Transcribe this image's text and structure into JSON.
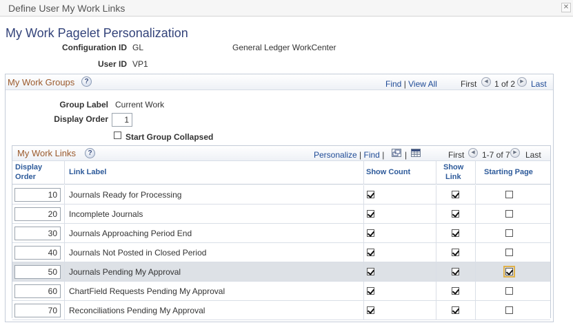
{
  "window": {
    "title": "Define User My Work Links",
    "close_glyph": "✕"
  },
  "page_title": "My Work Pagelet Personalization",
  "config": {
    "config_id_label": "Configuration ID",
    "config_id_value": "GL",
    "config_desc": "General Ledger WorkCenter",
    "user_id_label": "User ID",
    "user_id_value": "VP1"
  },
  "groups": {
    "title": "My Work Groups",
    "help_glyph": "?",
    "find": "Find",
    "view_all": "View All",
    "first": "First",
    "range": "1 of 2",
    "last": "Last",
    "group_label_label": "Group Label",
    "group_label_value": "Current Work",
    "display_order_label": "Display Order",
    "display_order_value": "1",
    "start_collapsed_label": "Start Group Collapsed",
    "start_collapsed_checked": false
  },
  "links": {
    "title": "My Work Links",
    "help_glyph": "?",
    "personalize": "Personalize",
    "find": "Find",
    "first": "First",
    "range": "1-7 of 7",
    "last": "Last",
    "columns": {
      "display_order_1": "Display",
      "display_order_2": "Order",
      "link_label": "Link Label",
      "show_count": "Show Count",
      "show_link_1": "Show",
      "show_link_2": "Link",
      "starting_page": "Starting Page"
    },
    "rows": [
      {
        "order": "10",
        "label": "Journals Ready for Processing",
        "show_count": true,
        "show_link": true,
        "starting_page": false
      },
      {
        "order": "20",
        "label": "Incomplete Journals",
        "show_count": true,
        "show_link": true,
        "starting_page": false
      },
      {
        "order": "30",
        "label": "Journals Approaching Period End",
        "show_count": true,
        "show_link": true,
        "starting_page": false
      },
      {
        "order": "40",
        "label": "Journals Not Posted in Closed Period",
        "show_count": true,
        "show_link": true,
        "starting_page": false
      },
      {
        "order": "50",
        "label": "Journals Pending My Approval",
        "show_count": true,
        "show_link": true,
        "starting_page": true
      },
      {
        "order": "60",
        "label": "ChartField Requests Pending My Approval",
        "show_count": true,
        "show_link": true,
        "starting_page": false
      },
      {
        "order": "70",
        "label": "Reconciliations Pending My Approval",
        "show_count": true,
        "show_link": true,
        "starting_page": false
      }
    ]
  },
  "icons": {
    "prev": "◀",
    "next": "▶"
  }
}
